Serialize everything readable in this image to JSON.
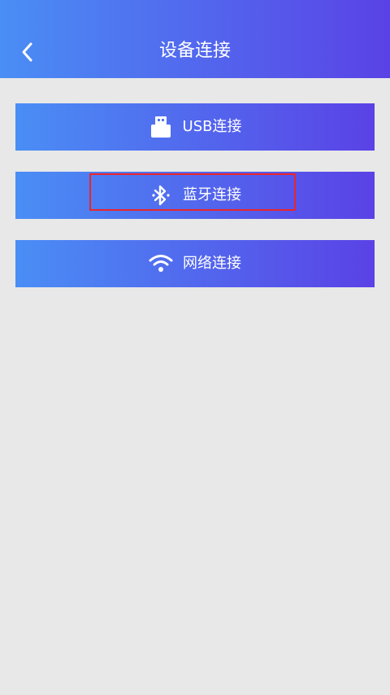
{
  "header": {
    "title": "设备连接",
    "back_icon": "chevron-left-icon",
    "gradient_start": "#4a8ef5",
    "gradient_end": "#5a42e6"
  },
  "connections": [
    {
      "label": "USB连接",
      "icon": "usb-icon"
    },
    {
      "label": "蓝牙连接",
      "icon": "bluetooth-icon"
    },
    {
      "label": "网络连接",
      "icon": "wifi-icon"
    }
  ],
  "highlight_color": "#e8262c",
  "background_color": "#e8e8e8"
}
